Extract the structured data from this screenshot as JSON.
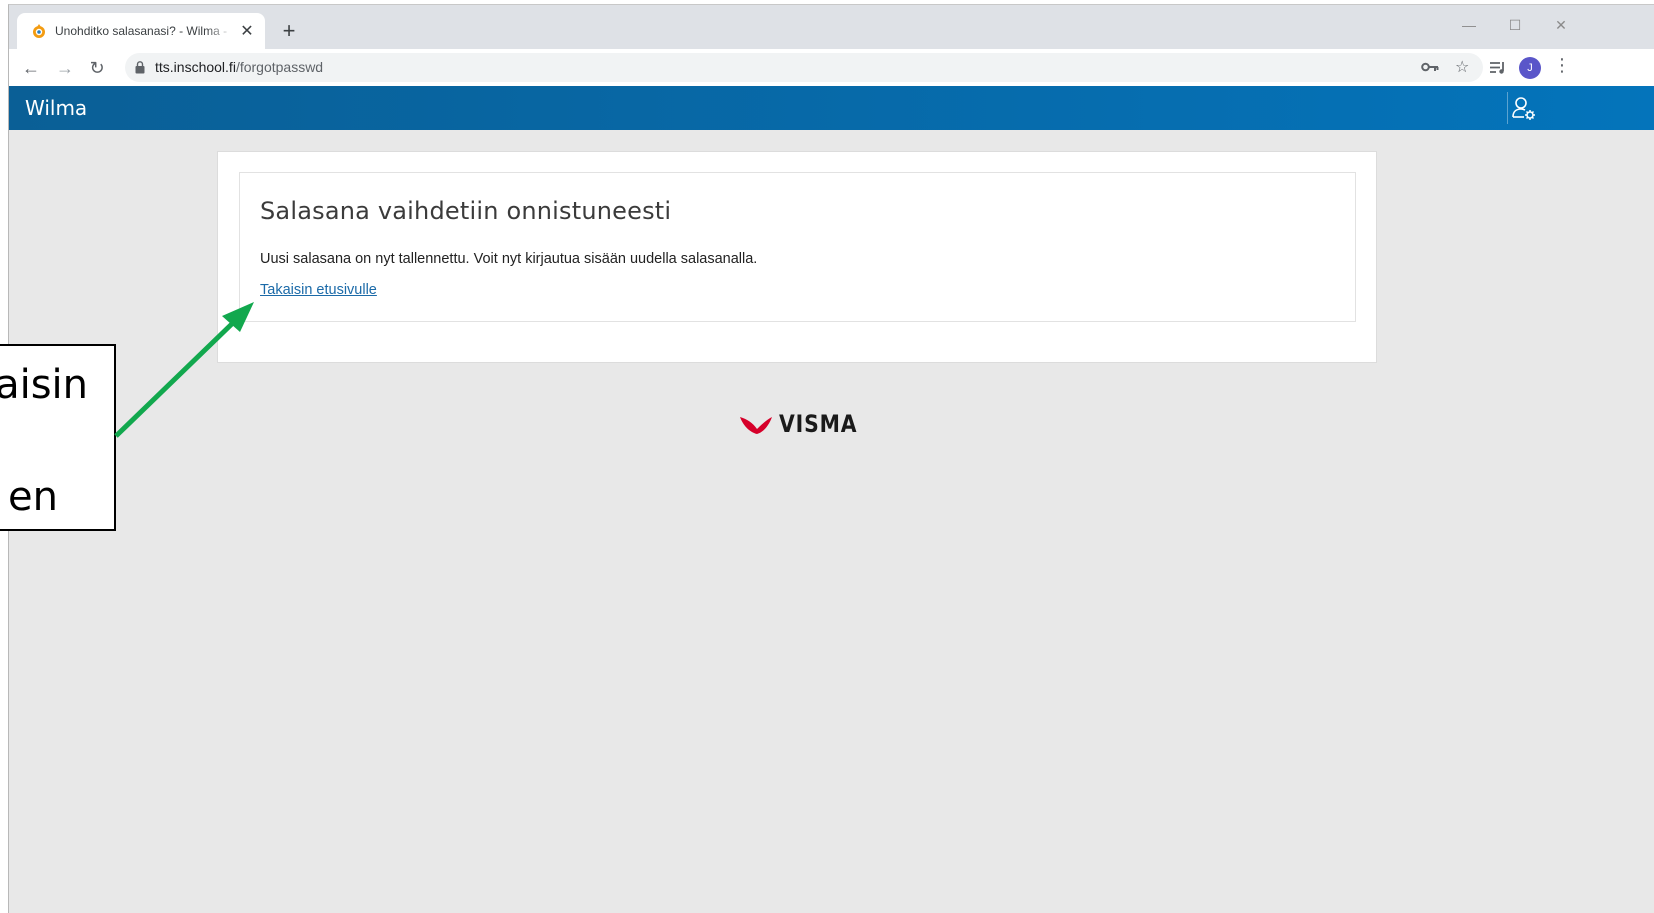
{
  "browser": {
    "tab_title": "Unohditko salasanasi? - Wilma - ",
    "tab_close": "✕",
    "new_tab": "+",
    "url_host": "tts.inschool.fi",
    "url_path": "/forgotpasswd",
    "profile_initial": "J"
  },
  "header": {
    "brand": "Wilma"
  },
  "content": {
    "heading": "Salasana vaihdetiin onnistuneesti",
    "message": "Uusi salasana on nyt tallennettu. Voit nyt kirjautua sisään uudella salasanalla.",
    "back_link": "Takaisin etusivulle"
  },
  "footer": {
    "logo_text": "VISMA"
  },
  "annotation": {
    "line1": "aisin",
    "line2": "en"
  },
  "colors": {
    "header_start": "#0a5f96",
    "header_end": "#0474bb",
    "link": "#1b6aa8",
    "visma_red": "#d6002a",
    "arrow": "#12a84e"
  }
}
